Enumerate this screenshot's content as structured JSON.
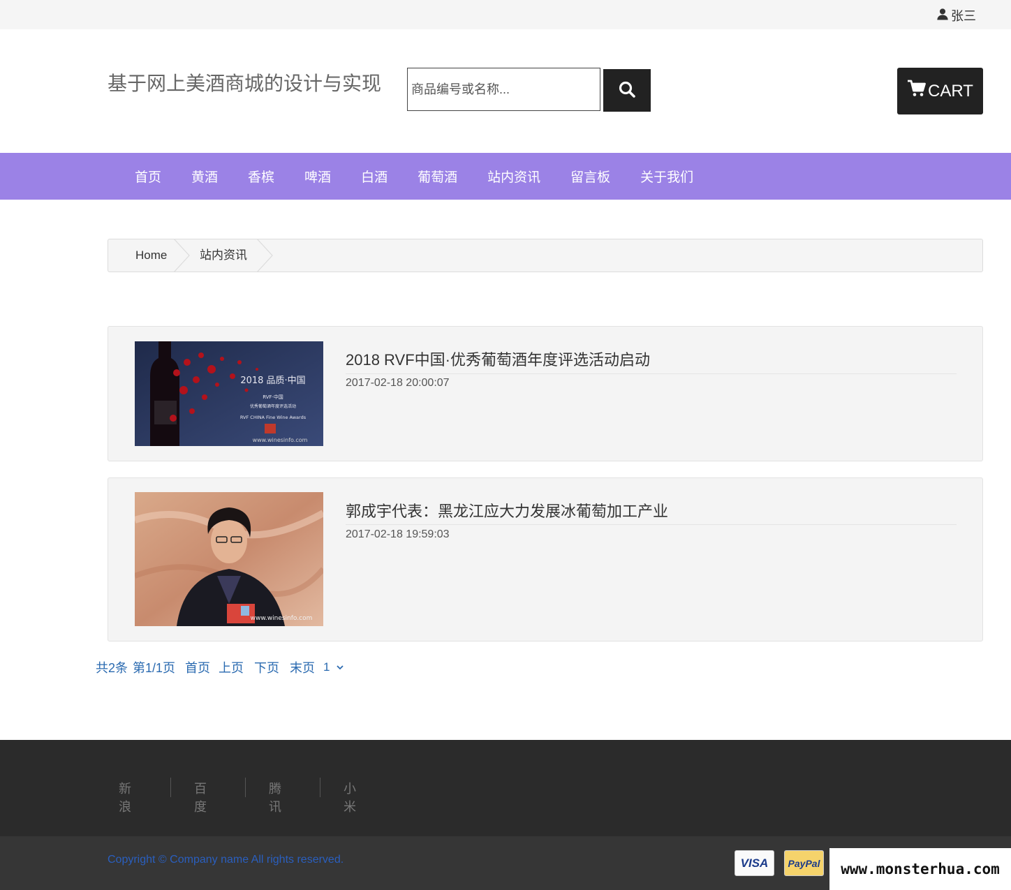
{
  "topbar": {
    "username": "张三",
    "user_icon": "user-icon"
  },
  "header": {
    "site_title": "基于网上美酒商城的设计与实现",
    "search_placeholder": "商品编号或名称...",
    "search_icon": "search-icon",
    "cart_label": "CART",
    "cart_icon": "cart-icon"
  },
  "nav": {
    "items": [
      "首页",
      "黄酒",
      "香槟",
      "啤酒",
      "白酒",
      "葡萄酒",
      "站内资讯",
      "留言板",
      "关于我们"
    ]
  },
  "breadcrumb": {
    "home": "Home",
    "current": "站内资讯"
  },
  "news": [
    {
      "title": "2018 RVF中国·优秀葡萄酒年度评选活动启动",
      "date": "2017-02-18 20:00:07",
      "image_text": {
        "headline": "2018 品质·中国",
        "line1": "RVF·中国",
        "line2": "优秀葡萄酒年度评选活动",
        "line3": "RVF CHINA Fine Wine Awards",
        "site": "www.winesinfo.com"
      }
    },
    {
      "title": "郭成宇代表：黑龙江应大力发展冰葡萄加工产业",
      "date": "2017-02-18 19:59:03",
      "image_text": {
        "site": "www.winesinfo.com"
      }
    }
  ],
  "pager": {
    "summary": "共2条",
    "page_info": "第1/1页",
    "first": "首页",
    "prev": "上页",
    "next": "下页",
    "last": "末页",
    "current_select": "1"
  },
  "footer": {
    "links": [
      "新浪",
      "百度",
      "腾讯",
      "小米"
    ],
    "copyright": "Copyright © Company name All rights reserved.",
    "payments": [
      "VISA",
      "PayPal"
    ]
  },
  "watermark": "www.monsterhua.com",
  "colors": {
    "nav_bg": "#9b82e6",
    "footer_bg": "#2b2b2b",
    "bottombar_bg": "#363636",
    "link_blue": "#2a6ab0"
  }
}
